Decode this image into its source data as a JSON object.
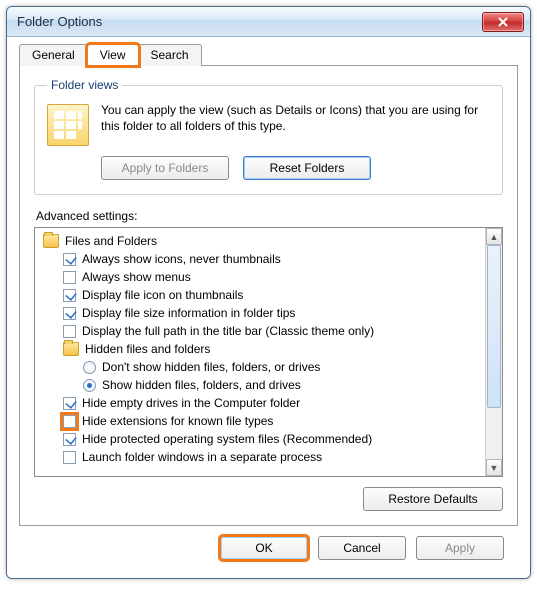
{
  "window": {
    "title": "Folder Options"
  },
  "tabs": {
    "general": "General",
    "view": "View",
    "search": "Search",
    "active": "view"
  },
  "folder_views": {
    "legend": "Folder views",
    "desc": "You can apply the view (such as Details or Icons) that you are using for this folder to all folders of this type.",
    "apply_btn": "Apply to Folders",
    "reset_btn": "Reset Folders"
  },
  "advanced": {
    "label": "Advanced settings:",
    "root": "Files and Folders",
    "items": [
      {
        "type": "check",
        "checked": true,
        "label": "Always show icons, never thumbnails"
      },
      {
        "type": "check",
        "checked": false,
        "label": "Always show menus"
      },
      {
        "type": "check",
        "checked": true,
        "label": "Display file icon on thumbnails"
      },
      {
        "type": "check",
        "checked": true,
        "label": "Display file size information in folder tips"
      },
      {
        "type": "check",
        "checked": false,
        "label": "Display the full path in the title bar (Classic theme only)"
      },
      {
        "type": "folder",
        "label": "Hidden files and folders"
      },
      {
        "type": "radio",
        "checked": false,
        "label": "Don't show hidden files, folders, or drives"
      },
      {
        "type": "radio",
        "checked": true,
        "label": "Show hidden files, folders, and drives"
      },
      {
        "type": "check",
        "checked": true,
        "label": "Hide empty drives in the Computer folder"
      },
      {
        "type": "check",
        "checked": false,
        "label": "Hide extensions for known file types",
        "highlight": true
      },
      {
        "type": "check",
        "checked": true,
        "label": "Hide protected operating system files (Recommended)"
      },
      {
        "type": "check",
        "checked": false,
        "label": "Launch folder windows in a separate process"
      }
    ],
    "restore_btn": "Restore Defaults"
  },
  "buttons": {
    "ok": "OK",
    "cancel": "Cancel",
    "apply": "Apply"
  }
}
